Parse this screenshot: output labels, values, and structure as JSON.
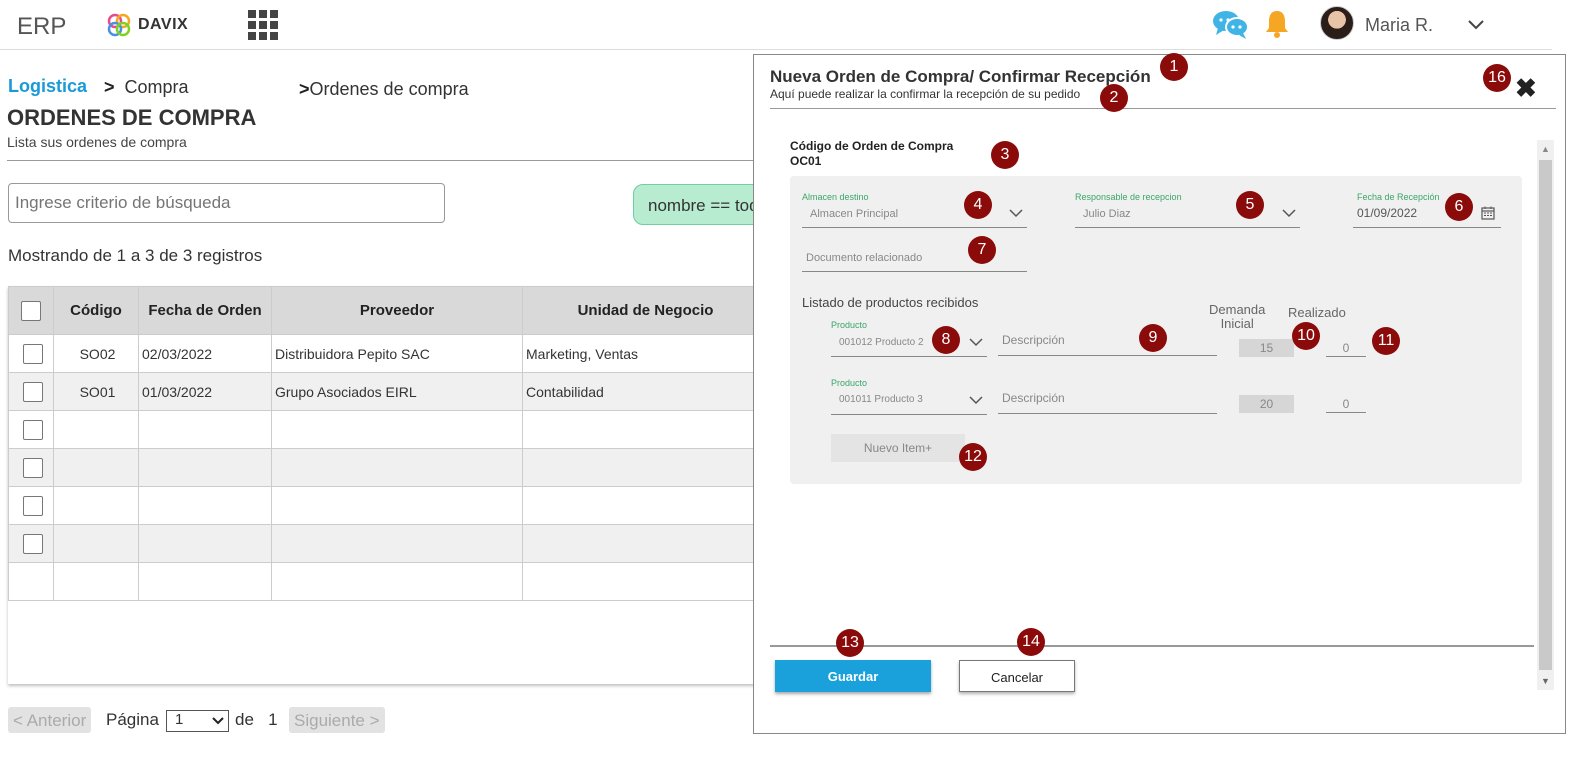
{
  "header": {
    "app_name": "ERP",
    "logo_text": "DAVIX",
    "user_name": "Maria R."
  },
  "breadcrumb": {
    "level1": "Logistica",
    "level2": "Compra",
    "level3": "Ordenes de compra"
  },
  "page": {
    "title": "ORDENES DE COMPRA",
    "subtitle": "Lista sus ordenes de compra"
  },
  "search": {
    "placeholder": "Ingrese criterio de búsqueda",
    "filter_chip": "nombre == todos"
  },
  "table": {
    "showing": "Mostrando de 1 a 3 de 3 registros",
    "columns": [
      "Código",
      "Fecha de Orden",
      "Proveedor",
      "Unidad de Negocio"
    ],
    "rows": [
      {
        "codigo": "SO02",
        "fecha": "02/03/2022",
        "proveedor": "Distribuidora Pepito SAC",
        "unidad": "Marketing, Ventas"
      },
      {
        "codigo": "SO01",
        "fecha": "01/03/2022",
        "proveedor": "Grupo Asociados EIRL",
        "unidad": "Contabilidad"
      }
    ]
  },
  "pager": {
    "prev": "< Anterior",
    "page_label": "Página",
    "page_value": "1",
    "of_label": "de",
    "total_pages": "1",
    "next": "Siguiente >"
  },
  "modal": {
    "title": "Nueva Orden de Compra/ Confirmar Recepción",
    "subtitle": "Aquí puede realizar la confirmar la recepción de su pedido",
    "code_label": "Código de Orden de Compra",
    "code_value": "OC01",
    "almacen": {
      "label": "Almacen destino",
      "value": "Almacen Principal"
    },
    "responsable": {
      "label": "Responsable de recepcion",
      "value": "Julio Diaz"
    },
    "fecha": {
      "label": "Fecha de Recepción",
      "value": "01/09/2022"
    },
    "documento_placeholder": "Documento relacionado",
    "products_label": "Listado de productos recibidos",
    "demanda_label_1": "Demanda",
    "demanda_label_2": "Inicial",
    "realizado_label": "Realizado",
    "products": [
      {
        "label": "Producto",
        "value": "001012 Producto 2",
        "description": "Descripción",
        "demanda": "15",
        "realizado": "0"
      },
      {
        "label": "Producto",
        "value": "001011 Producto 3",
        "description": "Descripción",
        "demanda": "20",
        "realizado": "0"
      }
    ],
    "new_item": "Nuevo Item+",
    "save": "Guardar",
    "cancel": "Cancelar"
  },
  "markers": [
    "1",
    "2",
    "3",
    "4",
    "5",
    "6",
    "7",
    "8",
    "9",
    "10",
    "11",
    "12",
    "13",
    "14",
    "16"
  ],
  "colors": {
    "accent_blue": "#1aa0db",
    "marker_red": "#8b0b0b",
    "chip_green": "#b7ecd0",
    "label_green": "#3aa66a"
  }
}
